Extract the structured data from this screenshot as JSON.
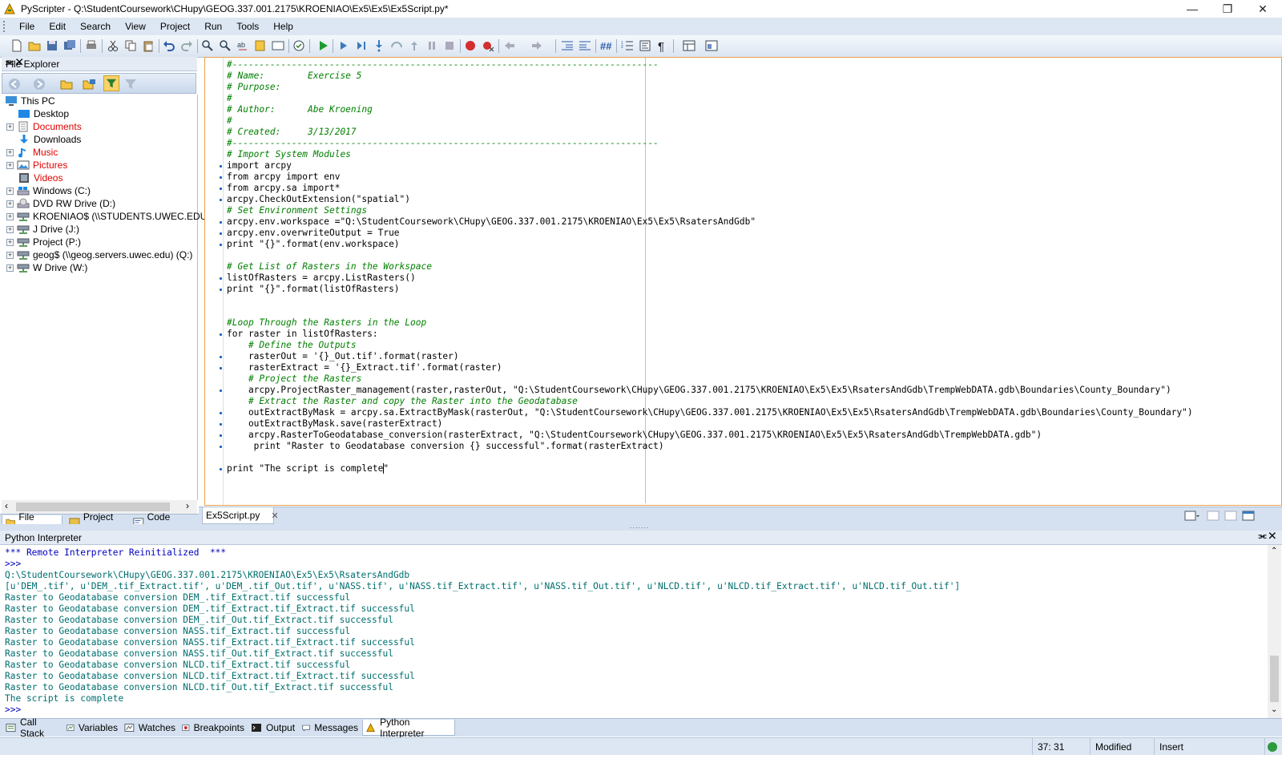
{
  "window": {
    "title": "PyScripter - Q:\\StudentCoursework\\CHupy\\GEOG.337.001.2175\\KROENIAO\\Ex5\\Ex5\\Ex5Script.py*"
  },
  "menu": [
    "File",
    "Edit",
    "Search",
    "View",
    "Project",
    "Run",
    "Tools",
    "Help"
  ],
  "file_explorer": {
    "title": "File Explorer",
    "tree": [
      {
        "label": "This PC",
        "icon": "computer-icon",
        "expander": false,
        "red": false
      },
      {
        "label": "Desktop",
        "icon": "desktop-icon",
        "expander": false,
        "red": false
      },
      {
        "label": "Documents",
        "icon": "documents-icon",
        "expander": true,
        "red": true
      },
      {
        "label": "Downloads",
        "icon": "downloads-icon",
        "expander": false,
        "red": false
      },
      {
        "label": "Music",
        "icon": "music-icon",
        "expander": true,
        "red": true
      },
      {
        "label": "Pictures",
        "icon": "pictures-icon",
        "expander": true,
        "red": true
      },
      {
        "label": "Videos",
        "icon": "videos-icon",
        "expander": false,
        "red": true
      },
      {
        "label": "Windows (C:)",
        "icon": "drive-icon",
        "expander": true,
        "red": false
      },
      {
        "label": "DVD RW Drive (D:)",
        "icon": "dvd-drive-icon",
        "expander": true,
        "red": false
      },
      {
        "label": "KROENIAO$ (\\\\STUDENTS.UWEC.EDU) (",
        "icon": "network-drive-icon",
        "expander": true,
        "red": false
      },
      {
        "label": "J Drive (J:)",
        "icon": "network-drive-icon",
        "expander": true,
        "red": false
      },
      {
        "label": "Project (P:)",
        "icon": "network-drive-icon",
        "expander": true,
        "red": false
      },
      {
        "label": "geog$ (\\\\geog.servers.uwec.edu) (Q:)",
        "icon": "network-drive-icon",
        "expander": true,
        "red": false
      },
      {
        "label": "W Drive (W:)",
        "icon": "network-drive-icon",
        "expander": true,
        "red": false
      }
    ],
    "tabs": [
      "File Expl...",
      "Project ...",
      "Code Ex..."
    ]
  },
  "editor": {
    "tab_label": "Ex5Script.py",
    "lines": [
      {
        "t": "#-------------------------------------------------------------------------------",
        "c": "cm",
        "dot": false
      },
      {
        "t": "# Name:        Exercise 5",
        "c": "cm",
        "dot": false
      },
      {
        "t": "# Purpose:",
        "c": "cm",
        "dot": false
      },
      {
        "t": "#",
        "c": "cm",
        "dot": false
      },
      {
        "t": "# Author:      Abe Kroening",
        "c": "cm",
        "dot": false
      },
      {
        "t": "#",
        "c": "cm",
        "dot": false
      },
      {
        "t": "# Created:     3/13/2017",
        "c": "cm",
        "dot": false
      },
      {
        "t": "#-------------------------------------------------------------------------------",
        "c": "cm",
        "dot": false
      },
      {
        "t": "# Import System Modules",
        "c": "cm",
        "dot": false
      },
      {
        "t": "import arcpy",
        "c": "code",
        "dot": true
      },
      {
        "t": "from arcpy import env",
        "c": "code",
        "dot": true
      },
      {
        "t": "from arcpy.sa import*",
        "c": "code",
        "dot": true
      },
      {
        "t": "arcpy.CheckOutExtension(\"spatial\")",
        "c": "code",
        "dot": true
      },
      {
        "t": "# Set Environment Settings",
        "c": "cm",
        "dot": false
      },
      {
        "t": "arcpy.env.workspace =\"Q:\\StudentCoursework\\CHupy\\GEOG.337.001.2175\\KROENIAO\\Ex5\\Ex5\\RsatersAndGdb\"",
        "c": "code",
        "dot": true
      },
      {
        "t": "arcpy.env.overwriteOutput = True",
        "c": "code",
        "dot": true
      },
      {
        "t": "print \"{}\".format(env.workspace)",
        "c": "code",
        "dot": true
      },
      {
        "t": "",
        "c": "code",
        "dot": false
      },
      {
        "t": "# Get List of Rasters in the Workspace",
        "c": "cm",
        "dot": false
      },
      {
        "t": "listOfRasters = arcpy.ListRasters()",
        "c": "code",
        "dot": true
      },
      {
        "t": "print \"{}\".format(listOfRasters)",
        "c": "code",
        "dot": true
      },
      {
        "t": "",
        "c": "code",
        "dot": false
      },
      {
        "t": "",
        "c": "code",
        "dot": false
      },
      {
        "t": "#Loop Through the Rasters in the Loop",
        "c": "cm",
        "dot": false
      },
      {
        "t": "for raster in listOfRasters:",
        "c": "code",
        "dot": true
      },
      {
        "t": "    # Define the Outputs",
        "c": "cm",
        "dot": false
      },
      {
        "t": "    rasterOut = '{}_Out.tif'.format(raster)",
        "c": "code",
        "dot": true
      },
      {
        "t": "    rasterExtract = '{}_Extract.tif'.format(raster)",
        "c": "code",
        "dot": true
      },
      {
        "t": "    # Project the Rasters",
        "c": "cm",
        "dot": false
      },
      {
        "t": "    arcpy.ProjectRaster_management(raster,rasterOut, \"Q:\\StudentCoursework\\CHupy\\GEOG.337.001.2175\\KROENIAO\\Ex5\\Ex5\\RsatersAndGdb\\TrempWebDATA.gdb\\Boundaries\\County_Boundary\")",
        "c": "code",
        "dot": true
      },
      {
        "t": "    # Extract the Raster and copy the Raster into the Geodatabase",
        "c": "cm",
        "dot": false
      },
      {
        "t": "    outExtractByMask = arcpy.sa.ExtractByMask(rasterOut, \"Q:\\StudentCoursework\\CHupy\\GEOG.337.001.2175\\KROENIAO\\Ex5\\Ex5\\RsatersAndGdb\\TrempWebDATA.gdb\\Boundaries\\County_Boundary\")",
        "c": "code",
        "dot": true
      },
      {
        "t": "    outExtractByMask.save(rasterExtract)",
        "c": "code",
        "dot": true
      },
      {
        "t": "    arcpy.RasterToGeodatabase_conversion(rasterExtract, \"Q:\\StudentCoursework\\CHupy\\GEOG.337.001.2175\\KROENIAO\\Ex5\\Ex5\\RsatersAndGdb\\TrempWebDATA.gdb\")",
        "c": "code",
        "dot": true
      },
      {
        "t": "     print \"Raster to Geodatabase conversion {} successful\".format(rasterExtract)",
        "c": "code",
        "dot": true
      },
      {
        "t": "",
        "c": "code",
        "dot": false
      },
      {
        "t": "print \"The script is complete\"",
        "c": "code",
        "dot": true
      }
    ]
  },
  "interpreter": {
    "title": "Python Interpreter",
    "lines": [
      {
        "t": "*** Remote Interpreter Reinitialized  ***",
        "c": "blue"
      },
      {
        "t": ">>> ",
        "c": "blue"
      },
      {
        "t": "Q:\\StudentCoursework\\CHupy\\GEOG.337.001.2175\\KROENIAO\\Ex5\\Ex5\\RsatersAndGdb",
        "c": "teal"
      },
      {
        "t": "[u'DEM_.tif', u'DEM_.tif_Extract.tif', u'DEM_.tif_Out.tif', u'NASS.tif', u'NASS.tif_Extract.tif', u'NASS.tif_Out.tif', u'NLCD.tif', u'NLCD.tif_Extract.tif', u'NLCD.tif_Out.tif']",
        "c": "teal"
      },
      {
        "t": "Raster to Geodatabase conversion DEM_.tif_Extract.tif successful",
        "c": "teal"
      },
      {
        "t": "Raster to Geodatabase conversion DEM_.tif_Extract.tif_Extract.tif successful",
        "c": "teal"
      },
      {
        "t": "Raster to Geodatabase conversion DEM_.tif_Out.tif_Extract.tif successful",
        "c": "teal"
      },
      {
        "t": "Raster to Geodatabase conversion NASS.tif_Extract.tif successful",
        "c": "teal"
      },
      {
        "t": "Raster to Geodatabase conversion NASS.tif_Extract.tif_Extract.tif successful",
        "c": "teal"
      },
      {
        "t": "Raster to Geodatabase conversion NASS.tif_Out.tif_Extract.tif successful",
        "c": "teal"
      },
      {
        "t": "Raster to Geodatabase conversion NLCD.tif_Extract.tif successful",
        "c": "teal"
      },
      {
        "t": "Raster to Geodatabase conversion NLCD.tif_Extract.tif_Extract.tif successful",
        "c": "teal"
      },
      {
        "t": "Raster to Geodatabase conversion NLCD.tif_Out.tif_Extract.tif successful",
        "c": "teal"
      },
      {
        "t": "The script is complete",
        "c": "teal"
      },
      {
        "t": ">>> ",
        "c": "blue"
      }
    ]
  },
  "bottom_tabs": [
    "Call Stack",
    "Variables",
    "Watches",
    "Breakpoints",
    "Output",
    "Messages",
    "Python Interpreter"
  ],
  "status": {
    "position": "37: 31",
    "modified": "Modified",
    "mode": "Insert"
  }
}
